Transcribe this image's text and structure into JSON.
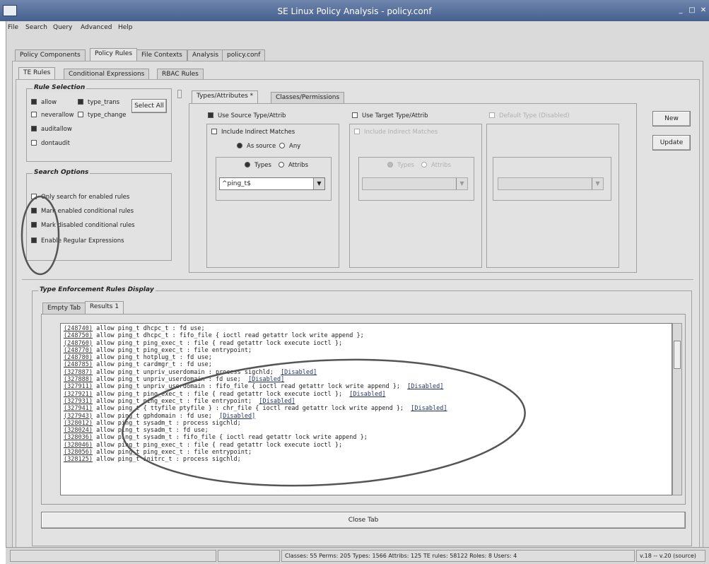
{
  "window": {
    "title": "SE Linux Policy Analysis - policy.conf",
    "controls": [
      "_",
      "□",
      "✕"
    ]
  },
  "menu": [
    "File",
    "Search",
    "Query",
    "Advanced",
    "Help"
  ],
  "top_tabs": [
    "Policy Components",
    "Policy Rules",
    "File Contexts",
    "Analysis",
    "policy.conf"
  ],
  "sub_tabs": [
    "TE Rules",
    "Conditional Expressions",
    "RBAC Rules"
  ],
  "rule_selection": {
    "title": "Rule Selection",
    "items": [
      {
        "label": "allow",
        "checked": true
      },
      {
        "label": "type_trans",
        "checked": true
      },
      {
        "label": "neverallow",
        "checked": false
      },
      {
        "label": "type_change",
        "checked": false
      },
      {
        "label": "auditallow",
        "checked": true
      },
      {
        "label": "dontaudit",
        "checked": false
      }
    ],
    "select_all": "Select All"
  },
  "search_options": {
    "title": "Search Options",
    "items": [
      {
        "label": "Only search for enabled rules",
        "checked": false
      },
      {
        "label": "Mark enabled conditional rules",
        "checked": true
      },
      {
        "label": "Mark disabled conditional rules",
        "checked": true
      },
      {
        "label": "Enable Regular Expressions",
        "checked": true
      }
    ]
  },
  "type_tabs": [
    "Types/Attributes *",
    "Classes/Permissions"
  ],
  "source": {
    "use_label": "Use Source Type/Attrib",
    "indirect_label": "Include Indirect Matches",
    "as_source": "As source",
    "any": "Any",
    "types": "Types",
    "attribs": "Attribs",
    "value": "^ping_t$"
  },
  "target": {
    "use_label": "Use Target Type/Attrib",
    "indirect_label": "Include Indirect Matches",
    "types": "Types",
    "attribs": "Attribs"
  },
  "default_type": {
    "label": "Default Type (Disabled)"
  },
  "buttons": {
    "new": "New",
    "update": "Update",
    "close_tab": "Close Tab"
  },
  "display": {
    "title": "Type Enforcement Rules Display",
    "tabs": [
      "Empty Tab",
      "Results 1"
    ],
    "lines": [
      {
        "num": "248740",
        "text": " allow ping_t dhcpc_t : fd use;",
        "link": ""
      },
      {
        "num": "248750",
        "text": " allow ping_t dhcpc_t : fifo_file { ioctl read getattr lock write append };",
        "link": ""
      },
      {
        "num": "248760",
        "text": " allow ping_t ping_exec_t : file { read getattr lock execute ioctl };",
        "link": ""
      },
      {
        "num": "248770",
        "text": " allow ping_t ping_exec_t : file entrypoint;",
        "link": ""
      },
      {
        "num": "248780",
        "text": " allow ping_t hotplug_t : fd use;",
        "link": ""
      },
      {
        "num": "248785",
        "text": " allow ping_t cardmgr_t : fd use;",
        "link": ""
      },
      {
        "num": "327887",
        "text": " allow ping_t unpriv_userdomain : process sigchld;  ",
        "link": "[Disabled]"
      },
      {
        "num": "327888",
        "text": " allow ping_t unpriv_userdomain : fd use;  ",
        "link": "[Disabled]"
      },
      {
        "num": "327911",
        "text": " allow ping_t unpriv_userdomain : fifo_file { ioctl read getattr lock write append };  ",
        "link": "[Disabled]"
      },
      {
        "num": "327921",
        "text": " allow ping_t ping_exec_t : file { read getattr lock execute ioctl };  ",
        "link": "[Disabled]"
      },
      {
        "num": "327931",
        "text": " allow ping_t ping_exec_t : file entrypoint;  ",
        "link": "[Disabled]"
      },
      {
        "num": "327941",
        "text": " allow ping_t { ttyfile ptyfile } : chr_file { ioctl read getattr lock write append };  ",
        "link": "[Disabled]"
      },
      {
        "num": "327943",
        "text": " allow ping_t gphdomain : fd use;  ",
        "link": "[Disabled]"
      },
      {
        "num": "328012",
        "text": " allow ping_t sysadm_t : process sigchld;",
        "link": ""
      },
      {
        "num": "328024",
        "text": " allow ping_t sysadm_t : fd use;",
        "link": ""
      },
      {
        "num": "328036",
        "text": " allow ping_t sysadm_t : fifo_file { ioctl read getattr lock write append };",
        "link": ""
      },
      {
        "num": "328046",
        "text": " allow ping_t ping_exec_t : file { read getattr lock execute ioctl };",
        "link": ""
      },
      {
        "num": "328056",
        "text": " allow ping_t ping_exec_t : file entrypoint;",
        "link": ""
      },
      {
        "num": "328125",
        "text": " allow ping_t initrc_t : process sigchld;",
        "link": ""
      }
    ]
  },
  "status": {
    "counts": "Classes: 55   Perms: 205   Types: 1566   Attribs: 125   TE rules: 58122   Roles: 8   Users: 4",
    "version": "v.18 -- v.20 (source)"
  }
}
